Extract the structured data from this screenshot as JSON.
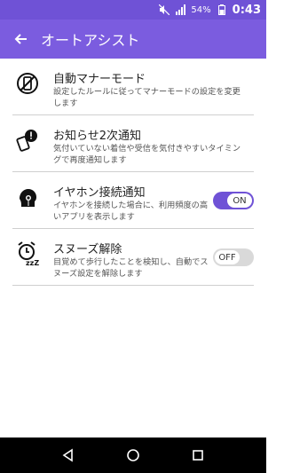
{
  "status_bar": {
    "battery_percent": "54%",
    "time": "0:43",
    "icons": [
      "mute-icon",
      "signal-icon",
      "battery-icon"
    ]
  },
  "app_bar": {
    "title": "オートアシスト",
    "back_icon": "back-arrow-icon"
  },
  "items": [
    {
      "title": "自動マナーモード",
      "description": "設定したルールに従ってマナーモードの設定を変更します",
      "icon": "phone-silent-icon"
    },
    {
      "title": "お知らせ2次通知",
      "description": "気付いていない着信や受信を気付きやすいタイミングで再度通知します",
      "icon": "notification-alert-icon"
    },
    {
      "title": "イヤホン接続通知",
      "description": "イヤホンを接続した場合に、利用頻度の高いアプリを表示します",
      "icon": "earphone-head-icon",
      "toggle_label": "ON",
      "toggle_state": "on"
    },
    {
      "title": "スヌーズ解除",
      "description": "目覚めて歩行したことを検知し、自動でスヌーズ設定を解除します",
      "icon": "alarm-snooze-icon",
      "toggle_label": "OFF",
      "toggle_state": "off"
    }
  ],
  "nav_bar": {
    "buttons": [
      "back-nav-icon",
      "home-nav-icon",
      "recents-nav-icon"
    ]
  },
  "colors": {
    "accent": "#7b5cdf",
    "status_bar": "#6f52d6"
  }
}
